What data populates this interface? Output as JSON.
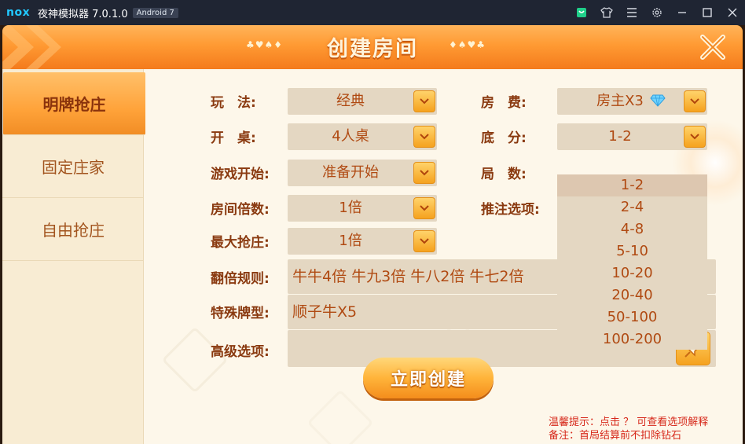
{
  "titlebar": {
    "logo": "nox",
    "title": "夜神模拟器 7.0.1.0",
    "android_badge": "Android 7",
    "icons": [
      "store-icon",
      "skin-icon",
      "menu-icon",
      "settings-icon",
      "minimize-icon",
      "maximize-icon",
      "close-icon"
    ]
  },
  "header": {
    "title": "创建房间",
    "suits_left": "♣♥♠♦",
    "suits_right": "♦♠♥♣"
  },
  "tabs": [
    {
      "label": "明牌抢庄",
      "active": true
    },
    {
      "label": "固定庄家",
      "active": false
    },
    {
      "label": "自由抢庄",
      "active": false
    }
  ],
  "form": {
    "play_label": "玩　法:",
    "play_value": "经典",
    "table_label": "开　桌:",
    "table_value": "4人桌",
    "start_label": "游戏开始:",
    "start_value": "准备开始",
    "multiplier_label": "房间倍数:",
    "multiplier_value": "1倍",
    "maxbid_label": "最大抢庄:",
    "maxbid_value": "1倍",
    "fee_label": "房　费:",
    "fee_value": "房主X3",
    "base_label": "底　分:",
    "base_value": "1-2",
    "rounds_label": "局　数:",
    "push_label": "推注选项:",
    "double_label": "翻倍规则:",
    "double_value": "牛牛4倍 牛九3倍 牛八2倍 牛七2倍",
    "special_label": "特殊牌型:",
    "special_value": "顺子牛X5",
    "advanced_label": "高级选项:"
  },
  "dropdown": {
    "options": [
      "1-2",
      "2-4",
      "4-8",
      "5-10",
      "10-20",
      "20-40",
      "50-100",
      "100-200"
    ],
    "selected": "1-2"
  },
  "create_button": "立即创建",
  "tips": {
    "line1": "温馨提示：点击 ？ 可查看选项解释",
    "line2": "备注：首局结算前不扣除钻石"
  },
  "colors": {
    "header_orange": "#ff9a33",
    "accent_text": "#b04a12",
    "label_text": "#8a3a10",
    "tip_red": "#d6281a",
    "field_bg": "#e4d7c2"
  }
}
